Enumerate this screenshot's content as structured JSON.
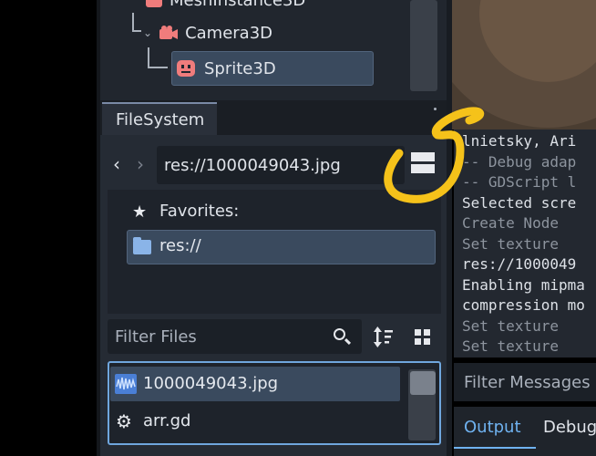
{
  "scene_tree": {
    "items": [
      {
        "label": "MeshInstance3D"
      },
      {
        "label": "Camera3D"
      },
      {
        "label": "Sprite3D"
      }
    ]
  },
  "filesystem": {
    "tab_label": "FileSystem",
    "path": "res://1000049043.jpg",
    "favorites_label": "Favorites:",
    "favorite_item": "res://",
    "filter_placeholder": "Filter Files",
    "files": [
      {
        "name": "1000049043.jpg",
        "icon": "image-file-icon"
      },
      {
        "name": "arr.gd",
        "icon": "gear-icon"
      }
    ]
  },
  "output": {
    "lines": [
      {
        "text": "lnietsky, Ari",
        "style": "normal"
      },
      {
        "text": "-- Debug adap",
        "style": "dim"
      },
      {
        "text": "-- GDScript l",
        "style": "dim"
      },
      {
        "text": "Selected scre",
        "style": "normal"
      },
      {
        "text": "Create Node",
        "style": "dim"
      },
      {
        "text": "Set texture",
        "style": "dim"
      },
      {
        "text": "res://1000049",
        "style": "normal"
      },
      {
        "text": "Enabling mipma",
        "style": "normal"
      },
      {
        "text": "compression mo",
        "style": "normal"
      },
      {
        "text": "Set texture",
        "style": "dim"
      },
      {
        "text": "Set texture",
        "style": "dim"
      }
    ],
    "filter_placeholder": "Filter Messages",
    "tabs": [
      "Output",
      "Debugger"
    ]
  },
  "colors": {
    "accent": "#6fb2f0",
    "annotation": "#f5c21a",
    "node_icon": "#f07c7c"
  }
}
